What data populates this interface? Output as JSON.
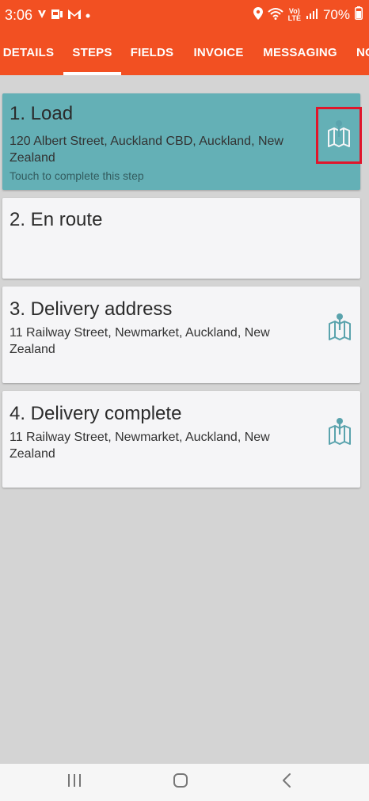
{
  "status_bar": {
    "time": "3:06",
    "left_icons": [
      "messenger-icon",
      "photo-icon",
      "gmail-icon",
      "dot-icon"
    ],
    "network_label_top": "Vo)",
    "network_label_bottom": "LTE",
    "battery": "70%"
  },
  "tabs": [
    {
      "label": "DETAILS",
      "active": false
    },
    {
      "label": "STEPS",
      "active": true
    },
    {
      "label": "FIELDS",
      "active": false
    },
    {
      "label": "INVOICE",
      "active": false
    },
    {
      "label": "MESSAGING",
      "active": false
    },
    {
      "label": "NO",
      "active": false
    }
  ],
  "steps": [
    {
      "title": "1. Load",
      "address": "120 Albert Street, Auckland CBD, Auckland, New Zealand",
      "hint": "Touch to complete this step",
      "has_map": true,
      "active": true
    },
    {
      "title": "2. En route",
      "address": "",
      "hint": "",
      "has_map": false,
      "active": false
    },
    {
      "title": "3. Delivery address",
      "address": "11 Railway Street, Newmarket, Auckland, New Zealand",
      "hint": "",
      "has_map": true,
      "active": false
    },
    {
      "title": "4. Delivery complete",
      "address": "11 Railway Street, Newmarket, Auckland, New Zealand",
      "hint": "",
      "has_map": true,
      "active": false
    }
  ],
  "colors": {
    "brand": "#f25022",
    "active_step": "#64b0b6",
    "map_icon": "#5aa3ad",
    "highlight": "#e0162b"
  },
  "nav_bar": [
    "recents-icon",
    "home-icon",
    "back-icon"
  ]
}
